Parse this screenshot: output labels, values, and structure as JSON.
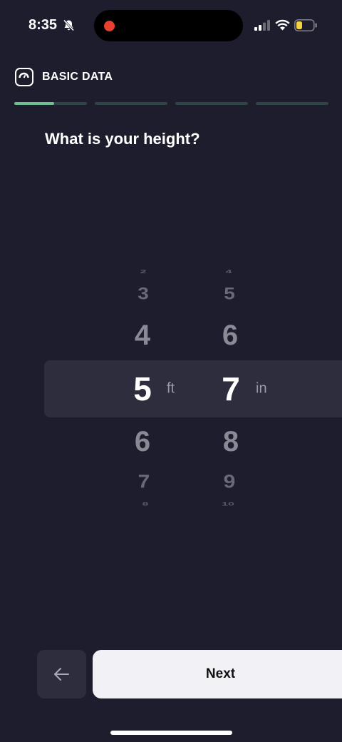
{
  "status_bar": {
    "time": "8:35",
    "icons": [
      "bell-slash-icon",
      "signal-icon",
      "wifi-icon",
      "battery-icon"
    ],
    "recording_color": "#e8402f",
    "battery_color": "#f5d343"
  },
  "header": {
    "icon": "scale-icon",
    "title": "BASIC DATA",
    "progress": {
      "segments": 4,
      "active_segment_fill": 0.55,
      "fill_color": "#6dbf8f",
      "track_color": "#2f4444"
    }
  },
  "question": "What is your height?",
  "picker": {
    "feet": {
      "values": [
        "2",
        "3",
        "4",
        "5",
        "6",
        "7",
        "8"
      ],
      "selected": "5",
      "unit": "ft"
    },
    "inches": {
      "values": [
        "4",
        "5",
        "6",
        "7",
        "8",
        "9",
        "10"
      ],
      "selected": "7",
      "unit": "in"
    }
  },
  "buttons": {
    "back_icon": "arrow-left-icon",
    "next_label": "Next"
  },
  "colors": {
    "background": "#1e1d2d",
    "panel": "#2e2d3d",
    "accent": "#6dbf8f"
  }
}
